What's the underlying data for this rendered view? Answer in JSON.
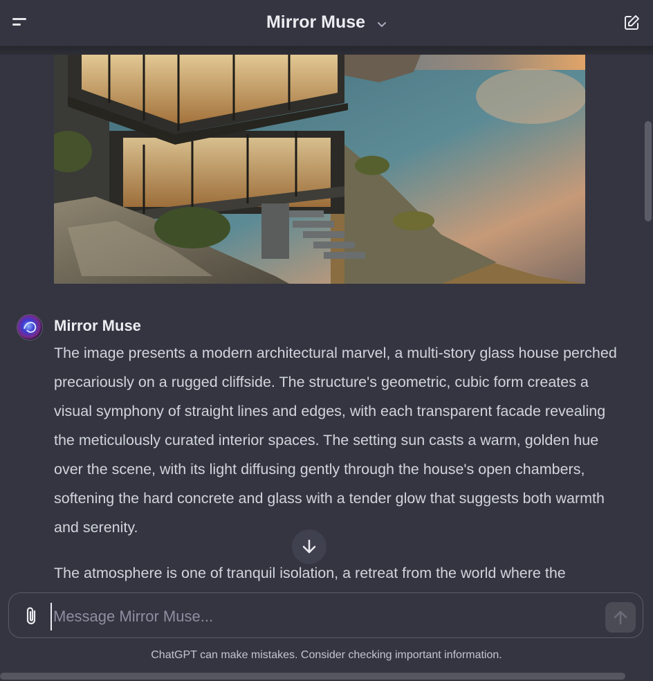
{
  "header": {
    "title": "Mirror Muse",
    "menu_icon": "menu-icon",
    "chevron_icon": "chevron-down-icon",
    "new_chat_icon": "edit-icon"
  },
  "message": {
    "sender": "Mirror Muse",
    "paragraphs": [
      "The image presents a modern architectural marvel, a multi-story glass house perched precariously on a rugged cliffside. The structure's geometric, cubic form creates a visual symphony of straight lines and edges, with each transparent facade revealing the meticulously curated interior spaces. The setting sun casts a warm, golden hue over the scene, with its light diffusing gently through the house's open chambers, softening the hard concrete and glass with a tender glow that suggests both warmth and serenity.",
      "The atmosphere is one of tranquil isolation, a retreat from the world where the"
    ]
  },
  "composer": {
    "placeholder": "Message Mirror Muse...",
    "value": ""
  },
  "footer": {
    "disclaimer": "ChatGPT can make mistakes. Consider checking important information."
  },
  "colors": {
    "background": "#343541",
    "text": "#ececf1",
    "body_text": "#d1d5db",
    "muted": "#8e8ea0"
  }
}
